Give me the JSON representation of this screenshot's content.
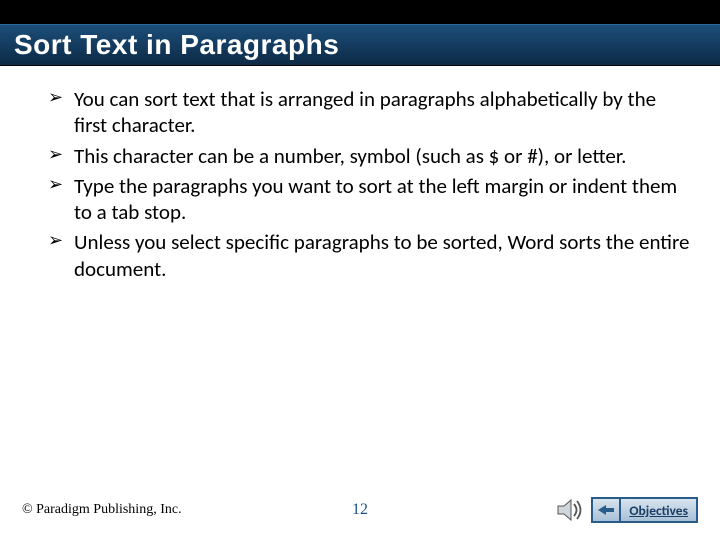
{
  "title": "Sort Text in Paragraphs",
  "bullets": [
    "You can sort text that is arranged in paragraphs alphabetically by the first character.",
    "This character can be a number, symbol (such as $ or #), or letter.",
    "Type the paragraphs you want to sort at the left margin or indent them to a tab stop.",
    "Unless you select specific paragraphs to be sorted, Word sorts the entire document."
  ],
  "footer": {
    "copyright": "© Paradigm Publishing, Inc.",
    "page": "12",
    "objectives_label": "Objectives"
  }
}
